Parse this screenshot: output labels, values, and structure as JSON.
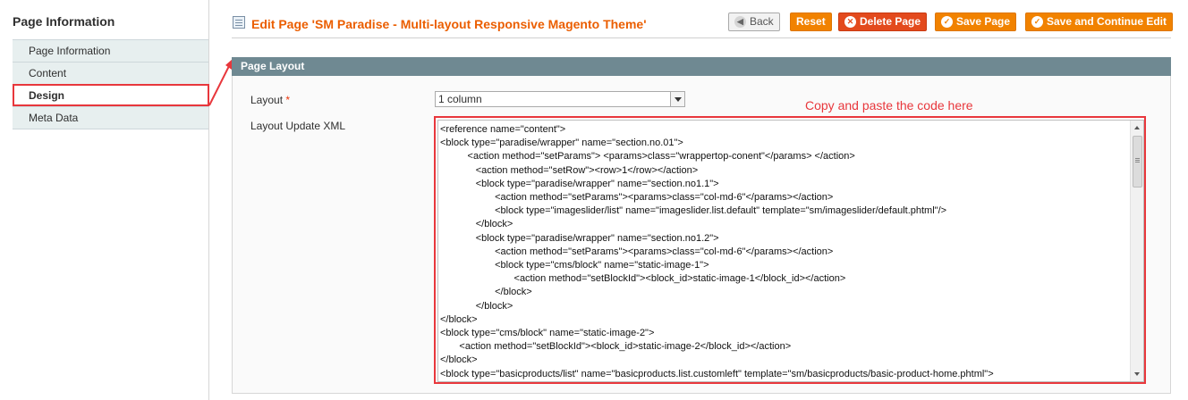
{
  "sidebar": {
    "title": "Page Information",
    "tabs": [
      {
        "label": "Page Information"
      },
      {
        "label": "Content"
      },
      {
        "label": "Design"
      },
      {
        "label": "Meta Data"
      }
    ]
  },
  "header": {
    "title": "Edit Page 'SM Paradise - Multi-layout Responsive Magento Theme'",
    "buttons": {
      "back": "Back",
      "reset": "Reset",
      "delete": "Delete Page",
      "save": "Save Page",
      "save_continue": "Save and Continue Edit"
    }
  },
  "section": {
    "title": "Page Layout",
    "layout_label": "Layout",
    "layout_required": "*",
    "layout_value": "1 column",
    "xml_label": "Layout Update XML",
    "annotation": "Copy and paste the code here",
    "xml_lines": [
      "<reference name=\"content\">",
      "<block type=\"paradise/wrapper\" name=\"section.no.01\">",
      "          <action method=\"setParams\"> <params>class=\"wrappertop-conent\"</params> </action>",
      "             <action method=\"setRow\"><row>1</row></action>",
      "             <block type=\"paradise/wrapper\" name=\"section.no1.1\">",
      "                    <action method=\"setParams\"><params>class=\"col-md-6\"</params></action>",
      "                    <block type=\"imageslider/list\" name=\"imageslider.list.default\" template=\"sm/imageslider/default.phtml\"/>",
      "             </block>",
      "             <block type=\"paradise/wrapper\" name=\"section.no1.2\">",
      "                    <action method=\"setParams\"><params>class=\"col-md-6\"</params></action>",
      "                    <block type=\"cms/block\" name=\"static-image-1\">",
      "                           <action method=\"setBlockId\"><block_id>static-image-1</block_id></action>",
      "                    </block>",
      "             </block>",
      "</block>",
      "<block type=\"cms/block\" name=\"static-image-2\">",
      "       <action method=\"setBlockId\"><block_id>static-image-2</block_id></action>",
      "</block>",
      "<block type=\"basicproducts/list\" name=\"basicproducts.list.customleft\" template=\"sm/basicproducts/basic-product-home.phtml\">"
    ]
  },
  "icons": {
    "back": "back-arrow-icon",
    "delete": "delete-icon",
    "save": "checkmark-icon"
  },
  "colors": {
    "accent": "#f18200",
    "heading": "#eb5e00",
    "section_header": "#6f8992",
    "annotation": "#e8373c"
  }
}
